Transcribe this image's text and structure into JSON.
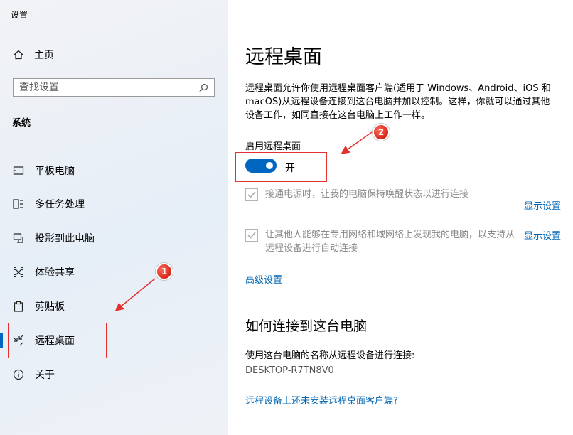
{
  "app_title": "设置",
  "sidebar": {
    "home_label": "主页",
    "search_placeholder": "查找设置",
    "section_title": "系统",
    "items": [
      {
        "label": "平板电脑"
      },
      {
        "label": "多任务处理"
      },
      {
        "label": "投影到此电脑"
      },
      {
        "label": "体验共享"
      },
      {
        "label": "剪贴板"
      },
      {
        "label": "远程桌面"
      },
      {
        "label": "关于"
      }
    ]
  },
  "main": {
    "title": "远程桌面",
    "description": "远程桌面允许你使用远程桌面客户端(适用于 Windows、Android、iOS 和 macOS)从远程设备连接到这台电脑并加以控制。这样，你就可以通过其他设备工作，如同直接在这台电脑上工作一样。",
    "toggle_label": "启用远程桌面",
    "toggle_state": "开",
    "option1": "接通电源时，让我的电脑保持唤醒状态以进行连接",
    "option2": "让其他人能够在专用网络和域网络上发现我的电脑，以支持从远程设备进行自动连接",
    "show_settings": "显示设置",
    "advanced": "高级设置",
    "how_title": "如何连接到这台电脑",
    "connect_label": "使用这台电脑的名称从远程设备进行连接:",
    "pc_name": "DESKTOP-R7TN8V0",
    "no_client_link": "远程设备上还未安装远程桌面客户端?"
  },
  "annotations": {
    "badge1": "1",
    "badge2": "2"
  },
  "colors": {
    "accent": "#0067c0",
    "highlight": "#e53030",
    "link": "#0066b4"
  }
}
